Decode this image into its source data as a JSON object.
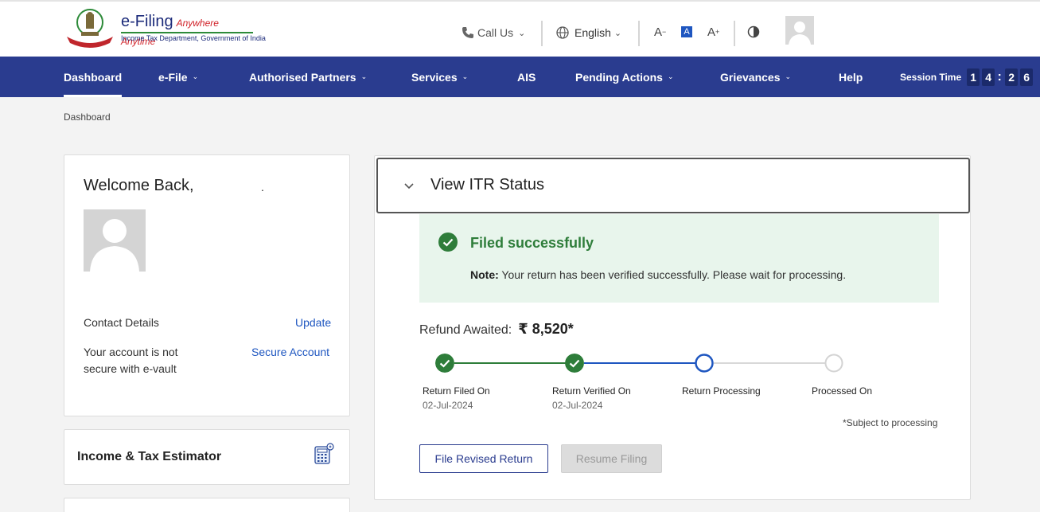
{
  "header": {
    "logo": {
      "title": "e-Filing",
      "tagline": "Anywhere Anytime",
      "subtitle": "Income Tax Department, Government of India"
    },
    "call_us": "Call Us",
    "language": "English",
    "font_decrease": "A",
    "font_default": "A",
    "font_increase": "A"
  },
  "nav": {
    "items": [
      {
        "label": "Dashboard"
      },
      {
        "label": "e-File"
      },
      {
        "label": "Authorised Partners"
      },
      {
        "label": "Services"
      },
      {
        "label": "AIS"
      },
      {
        "label": "Pending Actions"
      },
      {
        "label": "Grievances"
      },
      {
        "label": "Help"
      }
    ],
    "session_label": "Session Time",
    "session_digits": [
      "1",
      "4",
      "2",
      "6"
    ],
    "session_sep": ":"
  },
  "breadcrumb": "Dashboard",
  "profile": {
    "welcome": "Welcome Back,",
    "welcome_suffix": ".",
    "contact_label": "Contact Details",
    "update_link": "Update",
    "secure_line1": "Your account is not",
    "secure_line2": "secure with e-vault",
    "secure_link": "Secure Account"
  },
  "estimator": {
    "title": "Income & Tax Estimator"
  },
  "itr": {
    "title": "View ITR Status",
    "status_title": "Filed successfully",
    "note_label": "Note:",
    "note_text": "Your return has been verified successfully. Please wait for processing.",
    "refund_label": "Refund Awaited:",
    "refund_amount": "₹ 8,520*",
    "steps": [
      {
        "label": "Return Filed On",
        "date": "02-Jul-2024",
        "state": "done"
      },
      {
        "label": "Return Verified On",
        "date": "02-Jul-2024",
        "state": "done"
      },
      {
        "label": "Return Processing",
        "date": "",
        "state": "current"
      },
      {
        "label": "Processed On",
        "date": "",
        "state": "pending"
      }
    ],
    "subject_note": "*Subject to processing",
    "file_revised": "File Revised Return",
    "resume_filing": "Resume Filing"
  },
  "colors": {
    "nav_bg": "#2a3c8f",
    "success_green": "#2e7d3a",
    "success_bg": "#e8f5ec",
    "progress_blue": "#1e56c0",
    "link_blue": "#1e56c0"
  }
}
